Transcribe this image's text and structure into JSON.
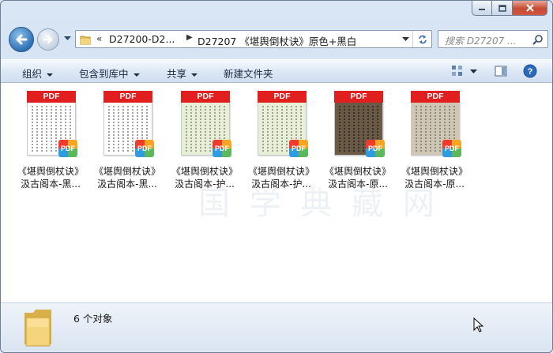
{
  "address": {
    "overflow_label": "«",
    "segments": [
      "D27200-D2...",
      "D27207 《堪舆倒杖诀》原色+黑白"
    ]
  },
  "search": {
    "placeholder": "搜索 D27207 ..."
  },
  "toolbar": {
    "organize": "组织",
    "include_library": "包含到库中",
    "share": "共享",
    "new_folder": "新建文件夹"
  },
  "files": [
    {
      "line1": "《堪舆倒杖诀》",
      "line2": "汲古阁本-黑...",
      "style": "white"
    },
    {
      "line1": "《堪舆倒杖诀》",
      "line2": "汲古阁本-黑...",
      "style": "white"
    },
    {
      "line1": "《堪舆倒杖诀》",
      "line2": "汲古阁本-护...",
      "style": "green"
    },
    {
      "line1": "《堪舆倒杖诀》",
      "line2": "汲古阁本-护...",
      "style": "green"
    },
    {
      "line1": "《堪舆倒杖诀》",
      "line2": "汲古阁本-原...",
      "style": "dark"
    },
    {
      "line1": "《堪舆倒杖诀》",
      "line2": "汲古阁本-原...",
      "style": "aged"
    }
  ],
  "pdf_label": "PDF",
  "status": {
    "count_text": "6 个对象"
  },
  "colors": {
    "pdf_red": "#e21f1f",
    "window_frame": "#c7d8ee",
    "close_red": "#c74b32"
  },
  "icons": [
    "minimize-icon",
    "maximize-icon",
    "close-icon",
    "back-arrow-icon",
    "forward-arrow-icon",
    "folder-icon",
    "refresh-icon",
    "search-icon",
    "view-options-icon",
    "preview-pane-icon",
    "help-icon",
    "pdf-file-icon",
    "mouse-cursor-icon"
  ]
}
